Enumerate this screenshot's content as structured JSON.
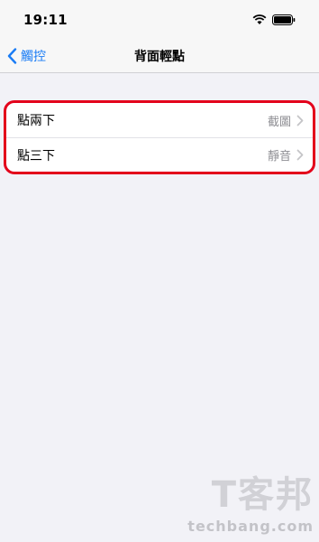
{
  "status": {
    "time": "19:11"
  },
  "nav": {
    "back_label": "觸控",
    "title": "背面輕點"
  },
  "list": {
    "items": [
      {
        "label": "點兩下",
        "value": "截圖"
      },
      {
        "label": "點三下",
        "value": "靜音"
      }
    ]
  },
  "watermark": {
    "brand": "T客邦",
    "site": "techbang.com"
  },
  "colors": {
    "accent": "#1a7cf5",
    "highlight": "#e3001b",
    "secondary_text": "#8e8e93"
  }
}
